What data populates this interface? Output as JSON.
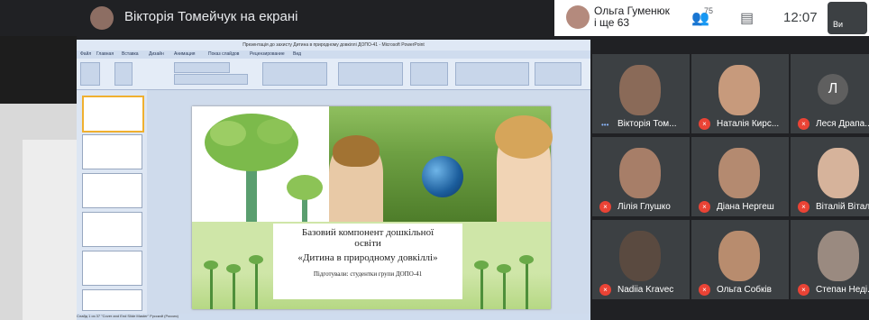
{
  "presentation_banner": {
    "presenter_text": "Вікторія Томейчук на екрані"
  },
  "top_right": {
    "speaker_name_line1": "Ольга Гуменюк",
    "speaker_name_line2": "і ще 63",
    "participant_count": "75",
    "time": "12:07",
    "self_label": "Ви"
  },
  "ppt": {
    "window_title": "Презентація до захисту Дитина в природному довкіллі ДОПО-41 - Microsoft PowerPoint",
    "tabs": [
      "Файл",
      "Главная",
      "Вставка",
      "Дизайн",
      "Анимация",
      "Показ слайдов",
      "Рецензирование",
      "Вид"
    ],
    "status_text": "Слайд 1 из 37   \"Cover and End Slide Master\"   Русский (Россия)"
  },
  "slide": {
    "line1": "Базовий компонент дошкільної",
    "line2": "освіти",
    "line3": "«Дитина в природному довкіллі»",
    "line4": "Підготували: студентки групи ДОПО-41"
  },
  "participants": [
    {
      "name": "Вікторія Том...",
      "status": "speaking",
      "face_color": "#8a6a58"
    },
    {
      "name": "Наталія Кирс...",
      "status": "muted",
      "face_color": "#c79a7c"
    },
    {
      "name": "Леся Драпа...",
      "status": "muted",
      "avatar_letter": "Л"
    },
    {
      "name": "Лілія Глушко",
      "status": "muted",
      "face_color": "#a77e68"
    },
    {
      "name": "Діана Нергеш",
      "status": "muted",
      "face_color": "#b48a70"
    },
    {
      "name": "Віталій Вітал...",
      "status": "muted",
      "face_color": "#d6b39b"
    },
    {
      "name": "Nadiia Kravec",
      "status": "muted",
      "face_color": "#5a4a40"
    },
    {
      "name": "Ольга Собків",
      "status": "muted",
      "face_color": "#b88c6e"
    },
    {
      "name": "Степан Неді...",
      "status": "muted",
      "face_color": "#9a8a80"
    }
  ]
}
